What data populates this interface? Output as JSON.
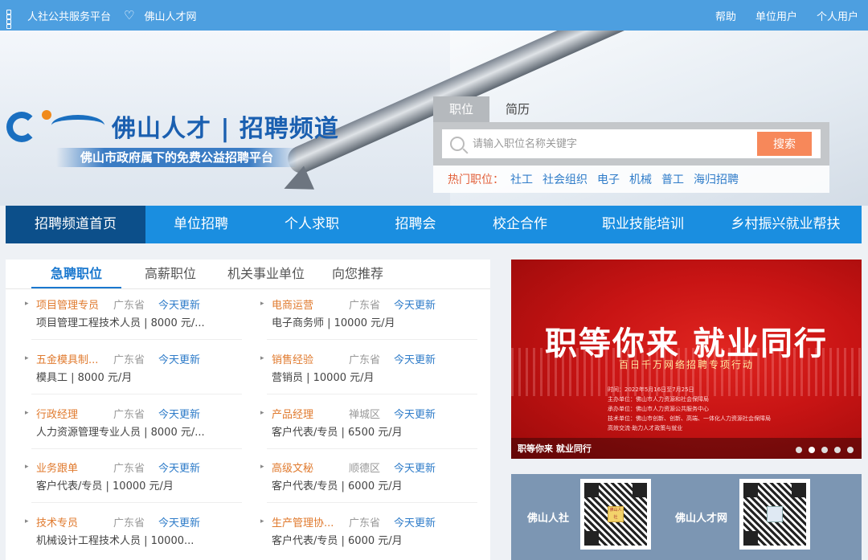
{
  "topbar": {
    "platform_label": "人社公共服务平台",
    "site_label": "佛山人才网",
    "links": [
      "帮助",
      "单位用户",
      "个人用户"
    ]
  },
  "hero": {
    "logo_text": "佛山人才 | 招聘频道",
    "slogan": "佛山市政府属下的免费公益招聘平台",
    "search": {
      "tabs": [
        "职位",
        "简历"
      ],
      "placeholder": "请输入职位名称关键字",
      "button": "搜索",
      "hot_label": "热门职位：",
      "hot_keywords": [
        "社工",
        "社会组织",
        "电子",
        "机械",
        "普工",
        "海归招聘"
      ]
    }
  },
  "nav": {
    "items": [
      "招聘频道首页",
      "单位招聘",
      "个人求职",
      "招聘会",
      "校企合作",
      "职业技能培训",
      "乡村振兴就业帮扶"
    ]
  },
  "jobs_panel": {
    "tabs": [
      "急聘职位",
      "高薪职位",
      "机关事业单位",
      "向您推荐"
    ],
    "jobs": [
      {
        "title": "项目管理专员",
        "location": "广东省",
        "update": "今天更新",
        "desc": "项目管理工程技术人员 | 8000 元/..."
      },
      {
        "title": "电商运营",
        "location": "广东省",
        "update": "今天更新",
        "desc": "电子商务师 | 10000 元/月"
      },
      {
        "title": "五金模具制...",
        "location": "广东省",
        "update": "今天更新",
        "desc": "模具工 | 8000 元/月"
      },
      {
        "title": "销售经验",
        "location": "广东省",
        "update": "今天更新",
        "desc": "营销员 | 10000 元/月"
      },
      {
        "title": "行政经理",
        "location": "广东省",
        "update": "今天更新",
        "desc": "人力资源管理专业人员 | 8000 元/..."
      },
      {
        "title": "产品经理",
        "location": "禅城区",
        "update": "今天更新",
        "desc": "客户代表/专员 | 6500 元/月"
      },
      {
        "title": "业务跟单",
        "location": "广东省",
        "update": "今天更新",
        "desc": "客户代表/专员 | 10000 元/月"
      },
      {
        "title": "高级文秘",
        "location": "顺德区",
        "update": "今天更新",
        "desc": "客户代表/专员 | 6000 元/月"
      },
      {
        "title": "技术专员",
        "location": "广东省",
        "update": "今天更新",
        "desc": "机械设计工程技术人员 | 10000..."
      },
      {
        "title": "生产管理协...",
        "location": "广东省",
        "update": "今天更新",
        "desc": "客户代表/专员 | 6000 元/月"
      }
    ]
  },
  "banner": {
    "headline": "职等你来  就业同行",
    "sub": "百日千万网络招聘专项行动",
    "lines": [
      "时间：2022年5月16日至7月25日",
      "主办单位：佛山市人力资源和社会保障局",
      "承办单位：佛山市人力资源公共服务中心",
      "技术单位：佛山市创新、创新、高端、一体化人力资源社会保障局",
      "高效交流·助力人才政策与就业"
    ],
    "caption": "职等你来 就业同行"
  },
  "qr": {
    "labels": [
      "佛山人社",
      "佛山人才网"
    ],
    "center_text": [
      "佛山人社",
      ""
    ]
  }
}
